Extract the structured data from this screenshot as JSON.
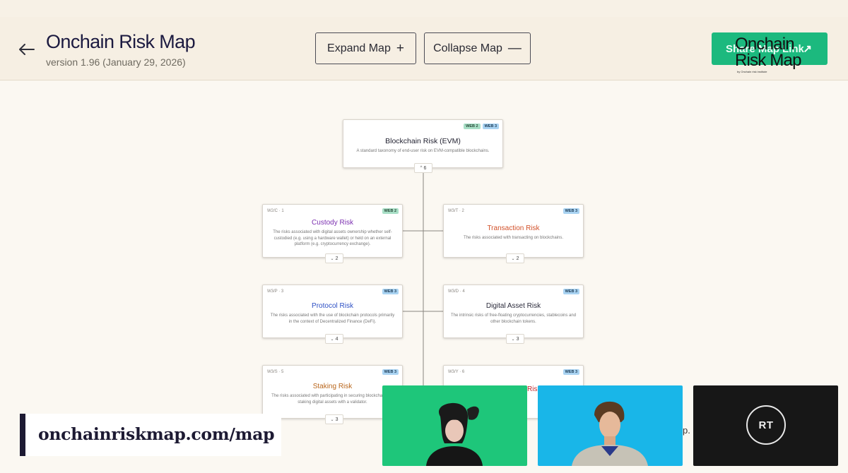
{
  "header": {
    "title": "Onchain Risk Map",
    "version": "version 1.96 (January 29, 2026)",
    "expand_label": "Expand Map",
    "expand_symbol": "+",
    "collapse_label": "Collapse Map",
    "collapse_symbol": "—",
    "share_label": "Share Map Link",
    "share_symbol": "↗",
    "logo_line1": "Onchain",
    "logo_line2": "Risk Map",
    "logo_tiny": "by Onchain risk institute"
  },
  "map": {
    "root": {
      "title": "Blockchain Risk (EVM)",
      "desc": "A standard taxonomy of end-user risk on EVM-compatible blockchains.",
      "tags": [
        "WEB 2",
        "WEB 3"
      ],
      "children_count": "6"
    },
    "nodes": [
      {
        "code": "W2/C · 1",
        "tag": "WEB 2",
        "title": "Custody Risk",
        "title_color": "#7b2fb0",
        "desc": "The risks associated with digital assets ownership whether self-custodied (e.g. using a hardware wallet) or held on an external platform (e.g. cryptocurrency exchange).",
        "count": "2"
      },
      {
        "code": "W3/T · 2",
        "tag": "WEB 3",
        "title": "Transaction Risk",
        "title_color": "#d2512a",
        "desc": "The risks associated with transacting on blockchains.",
        "count": "2"
      },
      {
        "code": "W3/P · 3",
        "tag": "WEB 3",
        "title": "Protocol Risk",
        "title_color": "#2c4fc4",
        "desc": "The risks associated with the use of blockchain protocols primarily in the context of Decentralized Finance (DeFi).",
        "count": "4"
      },
      {
        "code": "W3/D · 4",
        "tag": "WEB 3",
        "title": "Digital Asset Risk",
        "title_color": "#2a2a3a",
        "desc": "The intrinsic risks of free-floating cryptocurrencies, stablecoins and other blockchain tokens.",
        "count": "3"
      },
      {
        "code": "W3/S · 5",
        "tag": "WEB 3",
        "title": "Staking Risk",
        "title_color": "#b9661c",
        "desc": "The risks associated with participating in securing blockchains by staking digital assets with a validator.",
        "count": "3"
      },
      {
        "code": "W3/Y · 6",
        "tag": "WEB 3",
        "title": "Risk",
        "title_color": "#c0282d",
        "desc": "",
        "count": ""
      }
    ]
  },
  "overlay": {
    "url": "onchainriskmap.com/map",
    "trailing_text": "p.",
    "participant3_initials": "RT"
  },
  "colors": {
    "accent_green": "#1cb97e",
    "header_bg": "#f6efe3",
    "title_color": "#1c1a40"
  }
}
